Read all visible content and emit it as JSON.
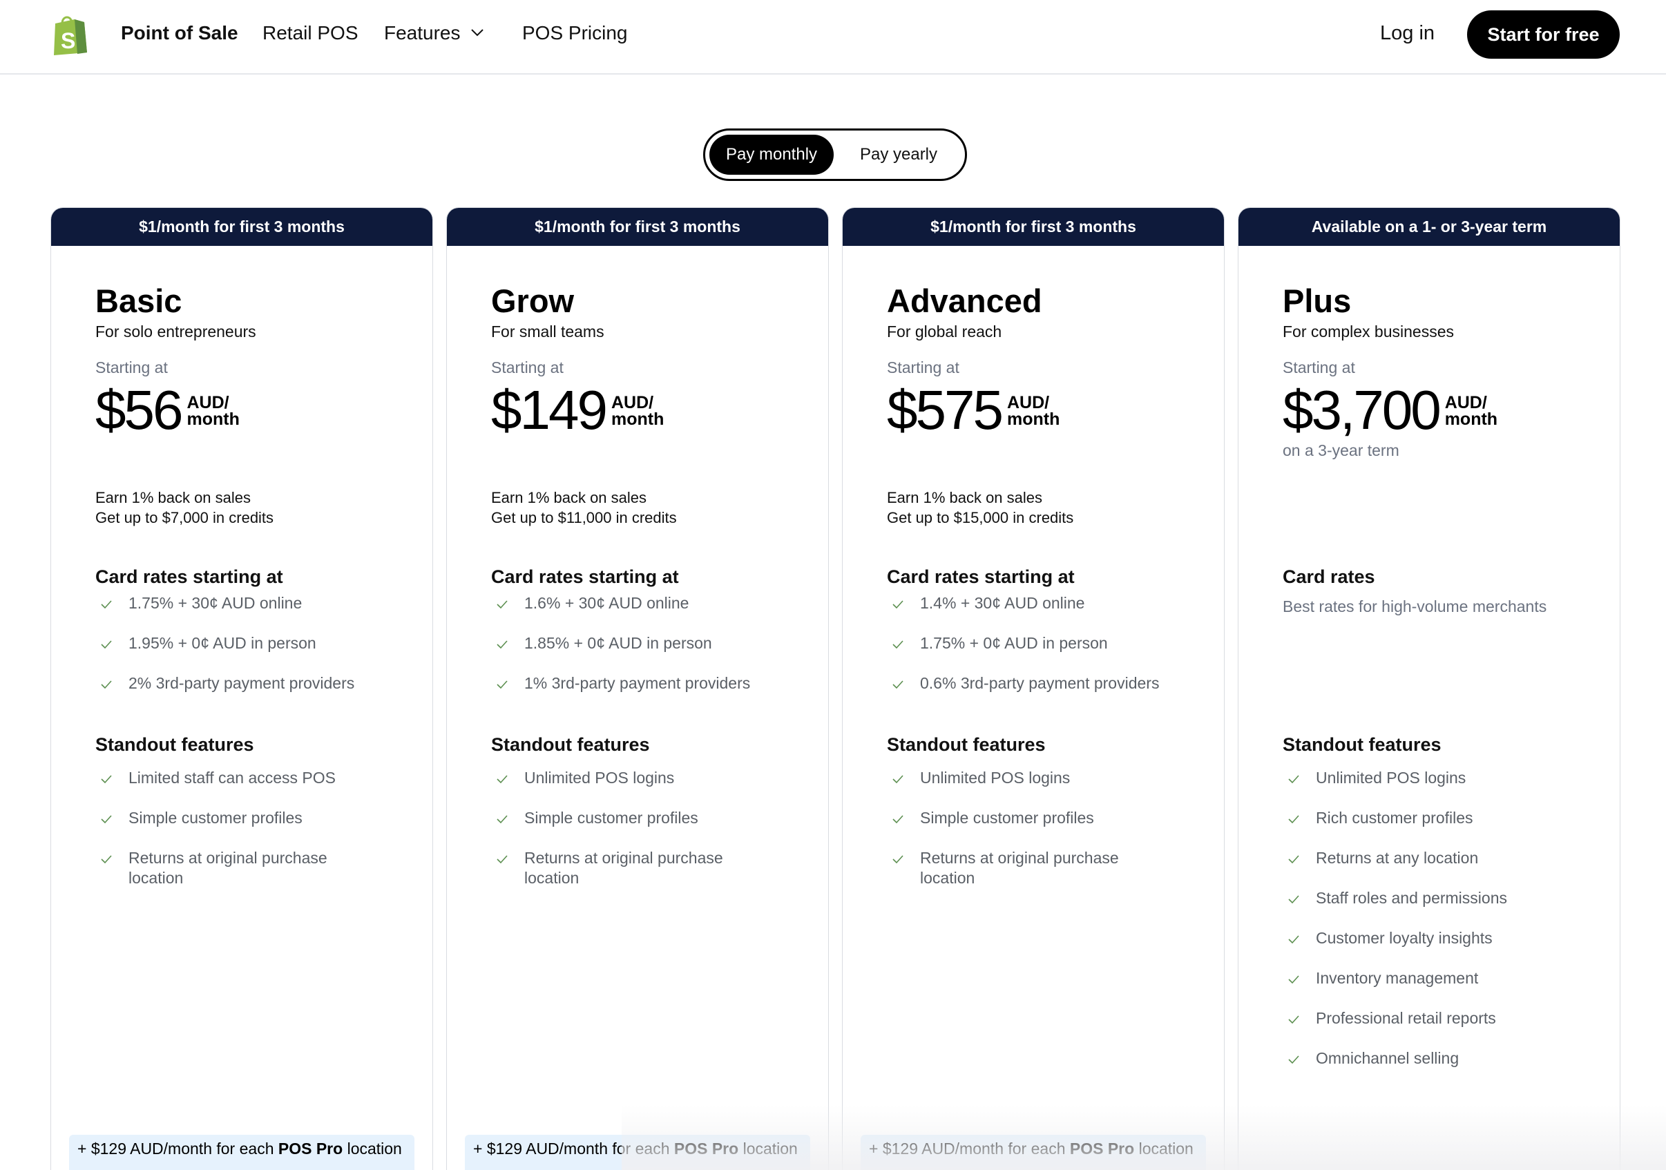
{
  "header": {
    "nav": {
      "point_of_sale": "Point of Sale",
      "retail_pos": "Retail POS",
      "features": "Features",
      "pos_pricing": "POS Pricing"
    },
    "login": "Log in",
    "start_free": "Start for free"
  },
  "billing_toggle": {
    "monthly": "Pay monthly",
    "yearly": "Pay yearly",
    "selected": "monthly"
  },
  "plans": [
    {
      "banner": "$1/month for first 3 months",
      "name": "Basic",
      "tagline": "For solo entrepreneurs",
      "starting": "Starting at",
      "price": "$56",
      "unit_top": "AUD/",
      "unit_bottom": "month",
      "perk1": "Earn 1% back on sales",
      "perk2": "Get up to $7,000 in credits",
      "rates_title": "Card rates starting at",
      "rates": [
        "1.75% + 30¢ AUD online",
        "1.95% + 0¢ AUD in person",
        "2% 3rd-party payment providers"
      ],
      "features_title": "Standout features",
      "features": [
        "Limited staff can access POS",
        "Simple customer profiles",
        "Returns at original purchase location"
      ],
      "addon_pre": "+ $129 AUD/month for each ",
      "addon_bold": "POS Pro",
      "addon_post": " location"
    },
    {
      "banner": "$1/month for first 3 months",
      "name": "Grow",
      "tagline": "For small teams",
      "starting": "Starting at",
      "price": "$149",
      "unit_top": "AUD/",
      "unit_bottom": "month",
      "perk1": "Earn 1% back on sales",
      "perk2": "Get up to $11,000 in credits",
      "rates_title": "Card rates starting at",
      "rates": [
        "1.6% + 30¢ AUD online",
        "1.85% + 0¢ AUD in person",
        "1% 3rd-party payment providers"
      ],
      "features_title": "Standout features",
      "features": [
        "Unlimited POS logins",
        "Simple customer profiles",
        "Returns at original purchase location"
      ],
      "addon_pre": "+ $129 AUD/month for each ",
      "addon_bold": "POS Pro",
      "addon_post": " location"
    },
    {
      "banner": "$1/month for first 3 months",
      "name": "Advanced",
      "tagline": "For global reach",
      "starting": "Starting at",
      "price": "$575",
      "unit_top": "AUD/",
      "unit_bottom": "month",
      "perk1": "Earn 1% back on sales",
      "perk2": "Get up to $15,000 in credits",
      "rates_title": "Card rates starting at",
      "rates": [
        "1.4% + 30¢ AUD online",
        "1.75% + 0¢ AUD in person",
        "0.6% 3rd-party payment providers"
      ],
      "features_title": "Standout features",
      "features": [
        "Unlimited POS logins",
        "Simple customer profiles",
        "Returns at original purchase location"
      ],
      "addon_pre": "+ $129 AUD/month for each ",
      "addon_bold": "POS Pro",
      "addon_post": " location"
    },
    {
      "banner": "Available on a 1- or 3-year term",
      "name": "Plus",
      "tagline": "For complex businesses",
      "starting": "Starting at",
      "price": "$3,700",
      "unit_top": "AUD/",
      "unit_bottom": "month",
      "term_note": "on a 3-year term",
      "rates_title": "Card rates",
      "rates_note": "Best rates for high-volume merchants",
      "features_title": "Standout features",
      "features": [
        "Unlimited POS logins",
        "Rich customer profiles",
        "Returns at any location",
        "Staff roles and permissions",
        "Customer loyalty insights",
        "Inventory management",
        "Professional retail reports",
        "Omnichannel selling"
      ]
    }
  ],
  "colors": {
    "banner": "#0e1a3b",
    "button": "#000000",
    "addon_bg": "#e6f2fd",
    "check": "#5c8f50",
    "logo_green": "#95bf47"
  },
  "icons": {
    "logo": "shopify-bag-icon",
    "features_chevron": "chevron-down-icon",
    "list_bullet": "check-icon"
  }
}
